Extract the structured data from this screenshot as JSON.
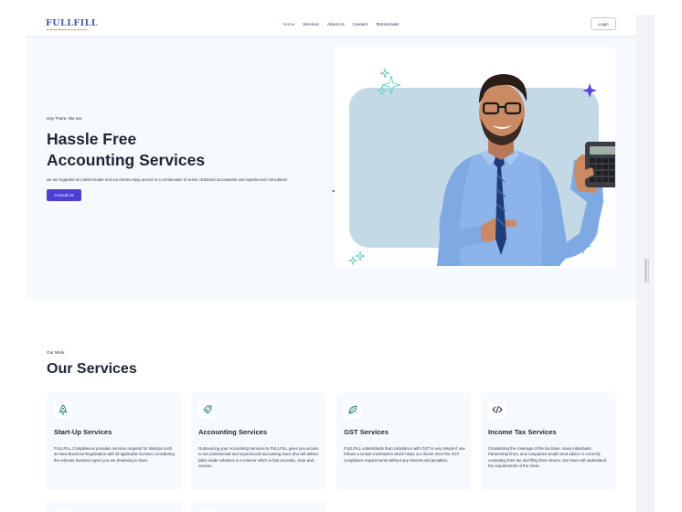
{
  "header": {
    "logo": "FULLFILL",
    "nav": [
      "Home",
      "Services",
      "About Us",
      "Careers",
      "Testimonials"
    ],
    "active_nav": "Home",
    "login_label": "Login"
  },
  "hero": {
    "eyebrow": "Hey There, We are",
    "title_line1": "Hassle Free",
    "title_line2": "Accounting Services",
    "subtitle": "we are regarded as market leader and our clients enjoy access to a combination of senior chartered accountants and experienced consultants",
    "cta_label": "Consult Us"
  },
  "services": {
    "eyebrow": "Our Work",
    "title": "Our Services",
    "items": [
      {
        "icon": "rocket-icon",
        "title": "Start-Up Services",
        "description": "FULLFILL Compliances provides services required for startups such as New Business Registration with all applicable licenses considering the relevant business types you are dreaming to have."
      },
      {
        "icon": "tag-icon",
        "title": "Accounting Services",
        "description": "Outsourcing your Accounting Services to FULLFILL gives you access to our professional and experienced accounting team who will deliver tailor-made solutions in a manner which is fast accurate, clear and concise."
      },
      {
        "icon": "leaf-icon",
        "title": "GST Services",
        "description": "FULLFILL understands that compliance with GST is very simple if one follows a certain mechanism which helps our clients meet the GST compliance requirements without any interest and penalties."
      },
      {
        "icon": "code-icon",
        "title": "Income Tax Services",
        "description": "Considering the coverage of the tax base, many individuals, Partnership firms, and companies would need advice in correctly computing their tax and filing their returns. Our team will understand the requirements of the client."
      }
    ]
  },
  "colors": {
    "accent": "#4b3fd6",
    "logo": "#4a57a8",
    "hero_bg": "#f6fafe",
    "photo_bg": "#c4d9e6",
    "sparkle_teal": "#6fd0c4",
    "sparkle_purple": "#5b44d8"
  }
}
